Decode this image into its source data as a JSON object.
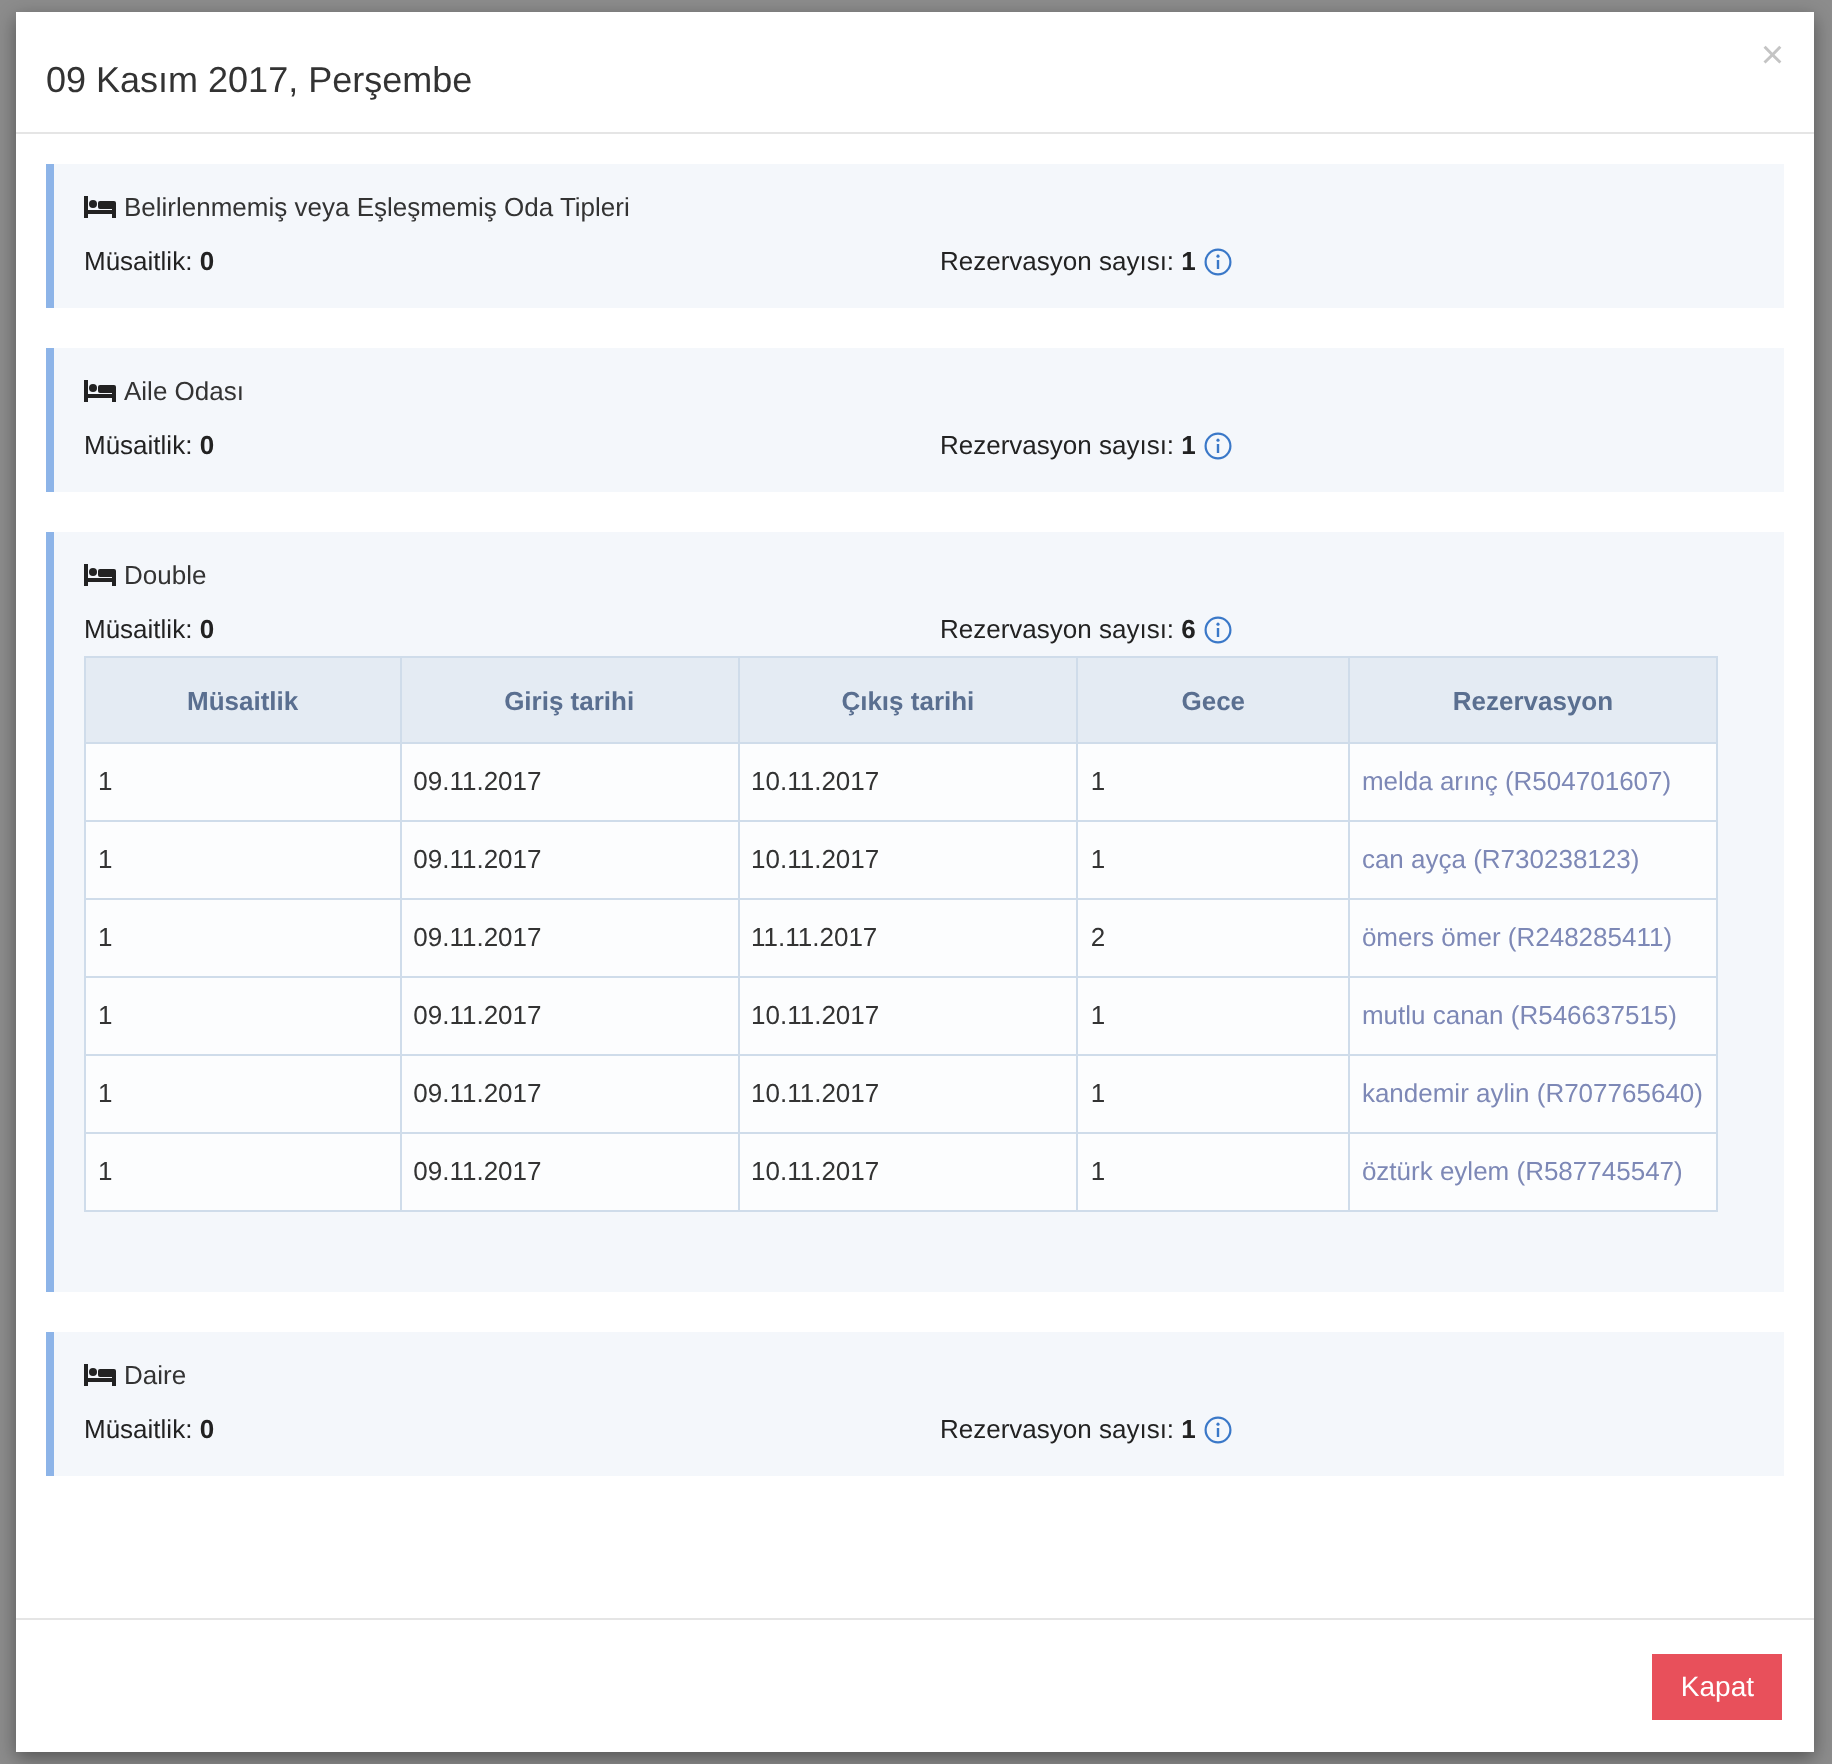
{
  "modal": {
    "title": "09 Kasım 2017, Perşembe",
    "close": "×",
    "button": "Kapat"
  },
  "room_types": [
    {
      "name": "Belirlenmemiş veya Eşleşmemiş Oda Tipleri",
      "availability_label": "Müsaitlik:",
      "availability": "0",
      "reservations_label": "Rezervasyon sayısı:",
      "reservations": "1"
    },
    {
      "name": "Aile Odası",
      "availability_label": "Müsaitlik:",
      "availability": "0",
      "reservations_label": "Rezervasyon sayısı:",
      "reservations": "1"
    },
    {
      "name": "Double",
      "availability_label": "Müsaitlik:",
      "availability": "0",
      "reservations_label": "Rezervasyon sayısı:",
      "reservations": "6",
      "table": {
        "columns": [
          "Müsaitlik",
          "Giriş tarihi",
          "Çıkış tarihi",
          "Gece",
          "Rezervasyon"
        ],
        "rows": [
          [
            "1",
            "09.11.2017",
            "10.11.2017",
            "1",
            "melda arınç (R504701607)"
          ],
          [
            "1",
            "09.11.2017",
            "10.11.2017",
            "1",
            "can ayça (R730238123)"
          ],
          [
            "1",
            "09.11.2017",
            "11.11.2017",
            "2",
            "ömers ömer (R248285411)"
          ],
          [
            "1",
            "09.11.2017",
            "10.11.2017",
            "1",
            "mutlu canan (R546637515)"
          ],
          [
            "1",
            "09.11.2017",
            "10.11.2017",
            "1",
            "kandemir aylin (R707765640)"
          ],
          [
            "1",
            "09.11.2017",
            "10.11.2017",
            "1",
            "öztürk eylem (R587745547)"
          ]
        ]
      }
    },
    {
      "name": "Daire",
      "availability_label": "Müsaitlik:",
      "availability": "0",
      "reservations_label": "Rezervasyon sayısı:",
      "reservations": "1"
    }
  ]
}
